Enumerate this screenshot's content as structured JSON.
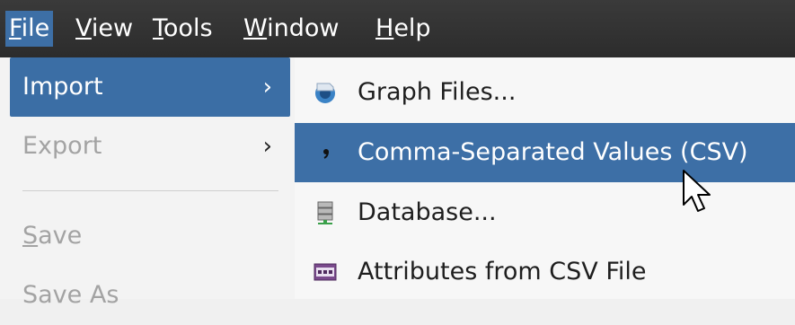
{
  "menubar": {
    "items": [
      {
        "prefix": "",
        "mnemonic": "F",
        "rest": "ile"
      },
      {
        "prefix": "",
        "mnemonic": "V",
        "rest": "iew"
      },
      {
        "prefix": "",
        "mnemonic": "T",
        "rest": "ools"
      },
      {
        "prefix": "",
        "mnemonic": "W",
        "rest": "indow"
      },
      {
        "prefix": "",
        "mnemonic": "H",
        "rest": "elp"
      }
    ]
  },
  "file_menu": {
    "items": [
      {
        "label": "Import",
        "state": "highlighted",
        "has_submenu": true,
        "arrow": "›"
      },
      {
        "label": "Export",
        "state": "disabled",
        "has_submenu": true,
        "arrow": "›"
      },
      {
        "mnemonic": "S",
        "rest": "ave",
        "state": "disabled"
      },
      {
        "label": "Save As",
        "state": "disabled"
      }
    ]
  },
  "import_menu": {
    "items": [
      {
        "label": "Graph Files...",
        "icon": "graph-files-icon"
      },
      {
        "label": "Comma-Separated Values (CSV)",
        "icon": "comma-icon",
        "state": "highlighted"
      },
      {
        "label": "Database...",
        "icon": "database-icon"
      },
      {
        "label": "Attributes from CSV File",
        "icon": "csv-file-icon"
      }
    ]
  },
  "colors": {
    "menubar_bg": "#2f2f2f",
    "highlight": "#3d6fa6",
    "menu_bg": "#f3f3f3",
    "disabled_text": "#a3a3a3"
  }
}
